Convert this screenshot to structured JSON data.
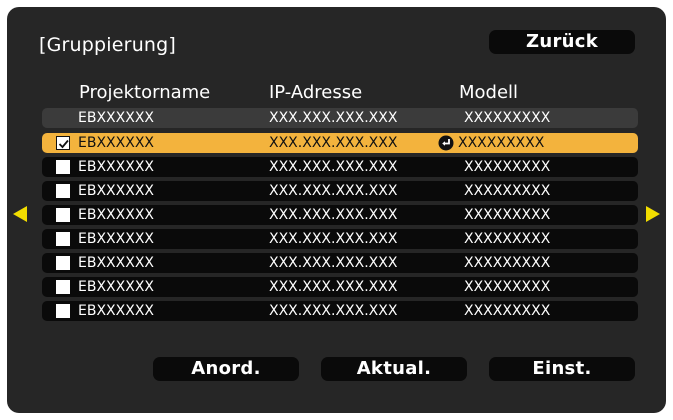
{
  "screen": {
    "title": "[Gruppierung]",
    "back_label": "Zurück"
  },
  "columns": {
    "name": "Projektorname",
    "ip": "IP-Adresse",
    "model": "Modell"
  },
  "rows": [
    {
      "name": "EBXXXXXX",
      "ip": "XXX.XXX.XXX.XXX",
      "model": "XXXXXXXXX",
      "checkbox": false,
      "checked": false,
      "selected": false
    },
    {
      "name": "EBXXXXXX",
      "ip": "XXX.XXX.XXX.XXX",
      "model": "XXXXXXXXX",
      "checkbox": true,
      "checked": true,
      "selected": true
    },
    {
      "name": "EBXXXXXX",
      "ip": "XXX.XXX.XXX.XXX",
      "model": "XXXXXXXXX",
      "checkbox": true,
      "checked": false,
      "selected": false
    },
    {
      "name": "EBXXXXXX",
      "ip": "XXX.XXX.XXX.XXX",
      "model": "XXXXXXXXX",
      "checkbox": true,
      "checked": false,
      "selected": false
    },
    {
      "name": "EBXXXXXX",
      "ip": "XXX.XXX.XXX.XXX",
      "model": "XXXXXXXXX",
      "checkbox": true,
      "checked": false,
      "selected": false
    },
    {
      "name": "EBXXXXXX",
      "ip": "XXX.XXX.XXX.XXX",
      "model": "XXXXXXXXX",
      "checkbox": true,
      "checked": false,
      "selected": false
    },
    {
      "name": "EBXXXXXX",
      "ip": "XXX.XXX.XXX.XXX",
      "model": "XXXXXXXXX",
      "checkbox": true,
      "checked": false,
      "selected": false
    },
    {
      "name": "EBXXXXXX",
      "ip": "XXX.XXX.XXX.XXX",
      "model": "XXXXXXXXX",
      "checkbox": true,
      "checked": false,
      "selected": false
    },
    {
      "name": "EBXXXXXX",
      "ip": "XXX.XXX.XXX.XXX",
      "model": "XXXXXXXXX",
      "checkbox": true,
      "checked": false,
      "selected": false
    }
  ],
  "buttons": {
    "sort": "Anord.",
    "refresh": "Aktual.",
    "settings": "Einst."
  },
  "icons": {
    "enter": "enter-icon",
    "left": "arrow-left-icon",
    "right": "arrow-right-icon"
  },
  "colors": {
    "panel": "#262626",
    "highlight": "#f3b33d",
    "arrow": "#f2dd00"
  }
}
